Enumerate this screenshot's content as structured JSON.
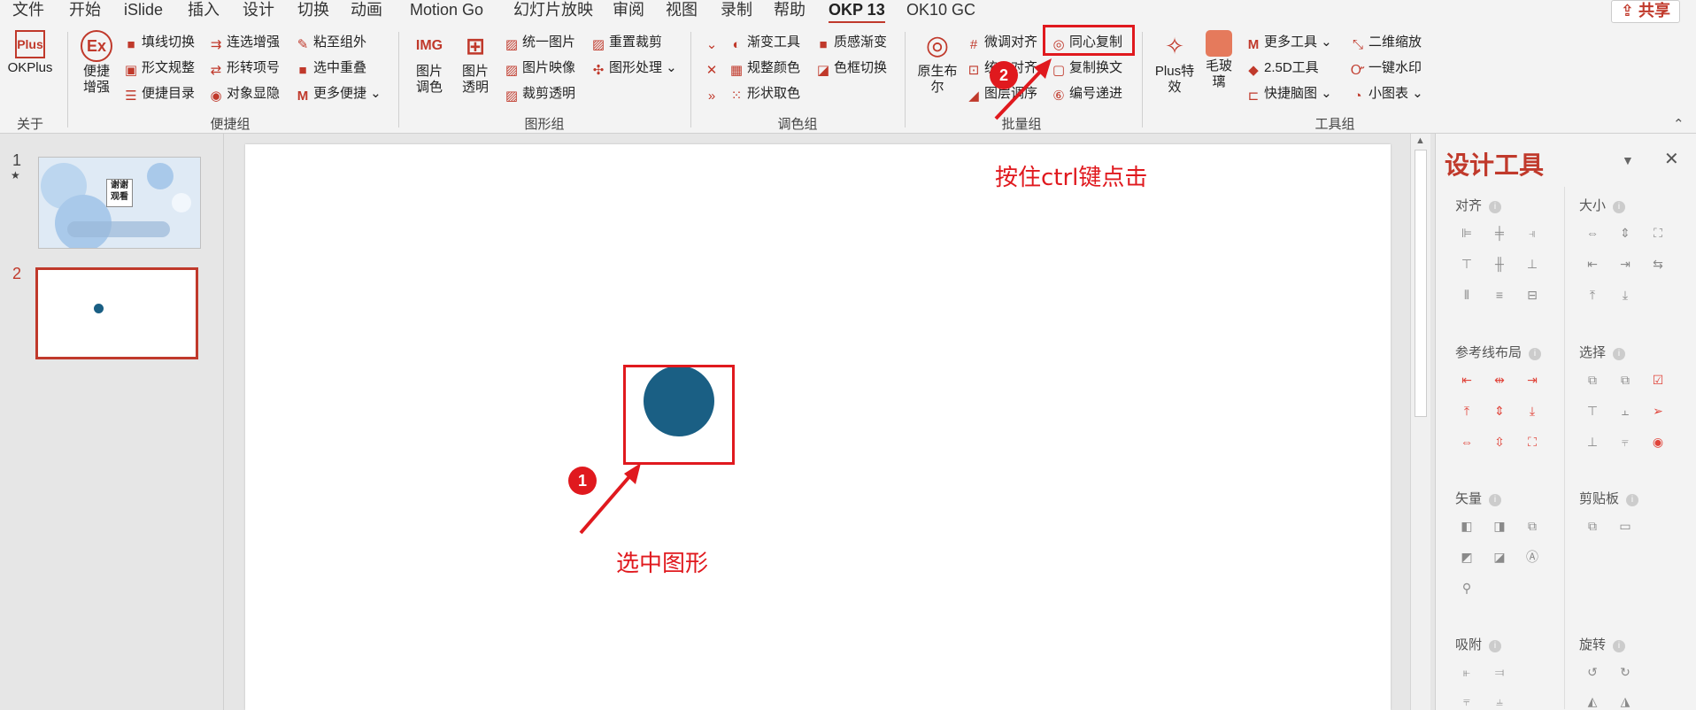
{
  "menubar": {
    "tabs": [
      "文件",
      "开始",
      "iSlide",
      "插入",
      "设计",
      "切换",
      "动画",
      "Motion Go",
      "幻灯片放映",
      "审阅",
      "视图",
      "录制",
      "帮助",
      "OKP 13",
      "OK10 GC"
    ],
    "active_tab": "OKP 13",
    "share_label": "共享"
  },
  "ribbon": {
    "okplus": {
      "label": "OKPlus",
      "group": "关于"
    },
    "bianjie_group": {
      "label": "便捷组",
      "big_label": "便捷增强",
      "items": [
        "填线切换",
        "连选增强",
        "粘至组外",
        "形文规整",
        "形转项号",
        "选中重叠",
        "便捷目录",
        "对象显隐",
        "更多便捷"
      ]
    },
    "tuxing_group": {
      "label": "图形组",
      "big1": "图片调色",
      "big2": "图片透明",
      "items": [
        "统一图片",
        "重置裁剪",
        "图片映像",
        "图形处理",
        "裁剪透明"
      ]
    },
    "tiaose_group": {
      "label": "调色组",
      "items": [
        "渐变工具",
        "质感渐变",
        "规整颜色",
        "色框切换",
        "形状取色"
      ]
    },
    "piliang_group": {
      "label": "批量组",
      "big_label": "原生布尔",
      "items": [
        "微调对齐",
        "同心复制",
        "统一对齐",
        "复制换文",
        "图层调序",
        "编号递进"
      ]
    },
    "gongju_group": {
      "label": "工具组",
      "big1": "Plus特效",
      "big2": "毛玻璃",
      "items": [
        "更多工具",
        "二维缩放",
        "2.5D工具",
        "一键水印",
        "快捷脑图",
        "小图表"
      ]
    }
  },
  "slides": [
    {
      "number": "1",
      "thumb_text": "谢谢观看"
    },
    {
      "number": "2"
    }
  ],
  "colors": {
    "accent": "#c0392b",
    "shape": "#1a5f84",
    "annotation": "#e0191e"
  },
  "annotations": {
    "step1_badge": "1",
    "step1_text": "选中图形",
    "step2_badge": "2",
    "step2_text": "按住ctrl键点击"
  },
  "design_pane": {
    "title": "设计工具",
    "sections": [
      "对齐",
      "大小",
      "参考线布局",
      "选择",
      "矢量",
      "剪贴板",
      "吸附",
      "旋转"
    ]
  }
}
